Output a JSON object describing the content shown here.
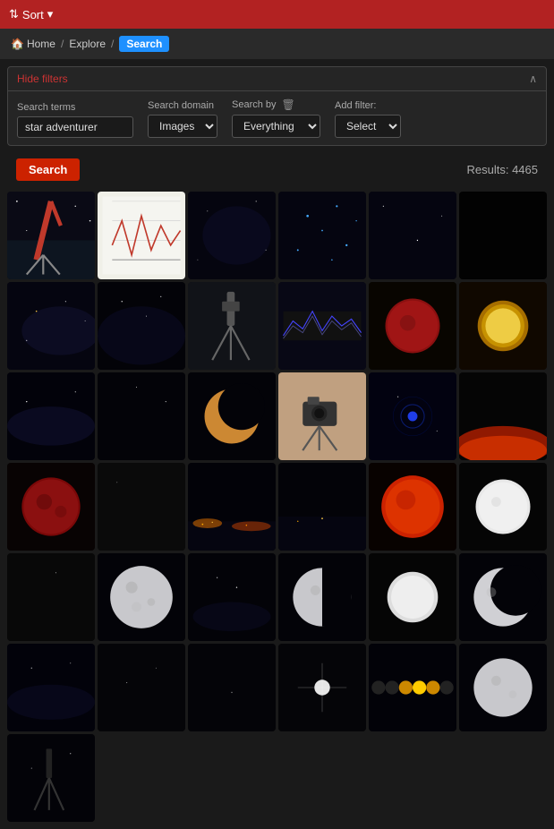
{
  "topbar": {
    "sort_label": "Sort"
  },
  "breadcrumb": {
    "home_label": "Home",
    "home_icon": "🏠",
    "sep1": "/",
    "explore_label": "Explore",
    "sep2": "/",
    "search_label": "Search"
  },
  "filters": {
    "hide_filters_label": "Hide filters",
    "search_terms_label": "Search terms",
    "search_terms_value": "star adventurer",
    "search_domain_label": "Search domain",
    "search_domain_value": "Images",
    "search_by_label": "Search by",
    "search_by_value": "Everything",
    "add_filter_label": "Add filter:",
    "add_filter_value": "Select"
  },
  "actions": {
    "search_button": "Search",
    "results_label": "Results: 4465"
  },
  "grid": {
    "images": [
      {
        "id": 1,
        "type": "telescope",
        "desc": "Red telescope on tripod against night sky"
      },
      {
        "id": 2,
        "type": "chart",
        "desc": "Scientific chart with waveform"
      },
      {
        "id": 3,
        "type": "dark-nebula",
        "desc": "Dark nebula"
      },
      {
        "id": 4,
        "type": "star-field",
        "desc": "Star field with blue dots"
      },
      {
        "id": 5,
        "type": "dark-sky",
        "desc": "Dark sky"
      },
      {
        "id": 6,
        "type": "very-dark",
        "desc": "Very dark image"
      },
      {
        "id": 7,
        "type": "milky-way",
        "desc": "Milky way galaxy"
      },
      {
        "id": 8,
        "type": "milky-way2",
        "desc": "Milky way star field"
      },
      {
        "id": 9,
        "type": "telescope2",
        "desc": "Telescope on tripod"
      },
      {
        "id": 10,
        "type": "spectrum",
        "desc": "Spectrum analysis chart"
      },
      {
        "id": 11,
        "type": "red-moon",
        "desc": "Blood red moon"
      },
      {
        "id": 12,
        "type": "sun-haze",
        "desc": "Sun through haze"
      },
      {
        "id": 13,
        "type": "milky3",
        "desc": "Milky way panorama"
      },
      {
        "id": 14,
        "type": "dark-sky2",
        "desc": "Dark sky"
      },
      {
        "id": 15,
        "type": "crescent",
        "desc": "Crescent moon"
      },
      {
        "id": 16,
        "type": "camera-mount",
        "desc": "Camera on mount"
      },
      {
        "id": 17,
        "type": "nebula-blue",
        "desc": "Blue nebula"
      },
      {
        "id": 18,
        "type": "horizon",
        "desc": "Red horizon"
      },
      {
        "id": 19,
        "type": "blood-moon2",
        "desc": "Blood moon eclipse"
      },
      {
        "id": 20,
        "type": "gray",
        "desc": "Gray dark"
      },
      {
        "id": 21,
        "type": "cityscape",
        "desc": "City lights panorama"
      },
      {
        "id": 22,
        "type": "lights",
        "desc": "Night lights"
      },
      {
        "id": 23,
        "type": "red-sun",
        "desc": "Red sun close-up"
      },
      {
        "id": 24,
        "type": "white-sun",
        "desc": "White sun"
      },
      {
        "id": 25,
        "type": "gray2",
        "desc": "Dark gray"
      },
      {
        "id": 26,
        "type": "full-moon",
        "desc": "Full moon"
      },
      {
        "id": 27,
        "type": "star-trail",
        "desc": "Star trail"
      },
      {
        "id": 28,
        "type": "quarter-moon",
        "desc": "Quarter moon"
      },
      {
        "id": 29,
        "type": "white-sun2",
        "desc": "White sun disk"
      },
      {
        "id": 30,
        "type": "half-moon",
        "desc": "Half moon"
      },
      {
        "id": 31,
        "type": "milky4",
        "desc": "Milky way trees"
      },
      {
        "id": 32,
        "type": "dark3",
        "desc": "Dark"
      },
      {
        "id": 33,
        "type": "dark4",
        "desc": "Dark"
      },
      {
        "id": 34,
        "type": "bright-star",
        "desc": "Bright star"
      },
      {
        "id": 35,
        "type": "eclipse-seq",
        "desc": "Eclipse sequence"
      },
      {
        "id": 36,
        "type": "full-moon2",
        "desc": "Full moon"
      },
      {
        "id": 37,
        "type": "silhouette",
        "desc": "Telescope silhouette"
      }
    ]
  }
}
